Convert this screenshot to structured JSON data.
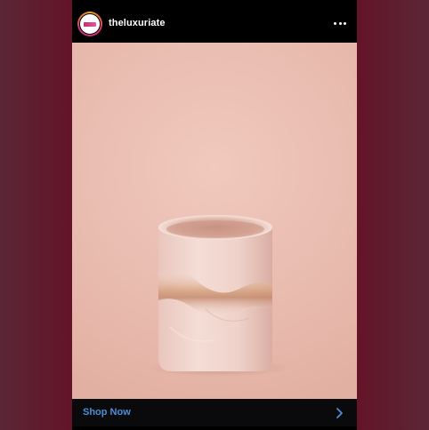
{
  "post": {
    "username": "theluxuriate",
    "avatar_icon": "theluxuriate-logo",
    "more_icon": "more-horizontal-icon",
    "image_subject": "pink onyx candle holder",
    "cta": {
      "label": "Shop Now",
      "icon": "chevron-right-icon",
      "color": "#4a8fd9"
    }
  },
  "colors": {
    "backdrop": "#5c1a2d",
    "image_background": "#ebbfb3",
    "header_background": "#000000"
  }
}
